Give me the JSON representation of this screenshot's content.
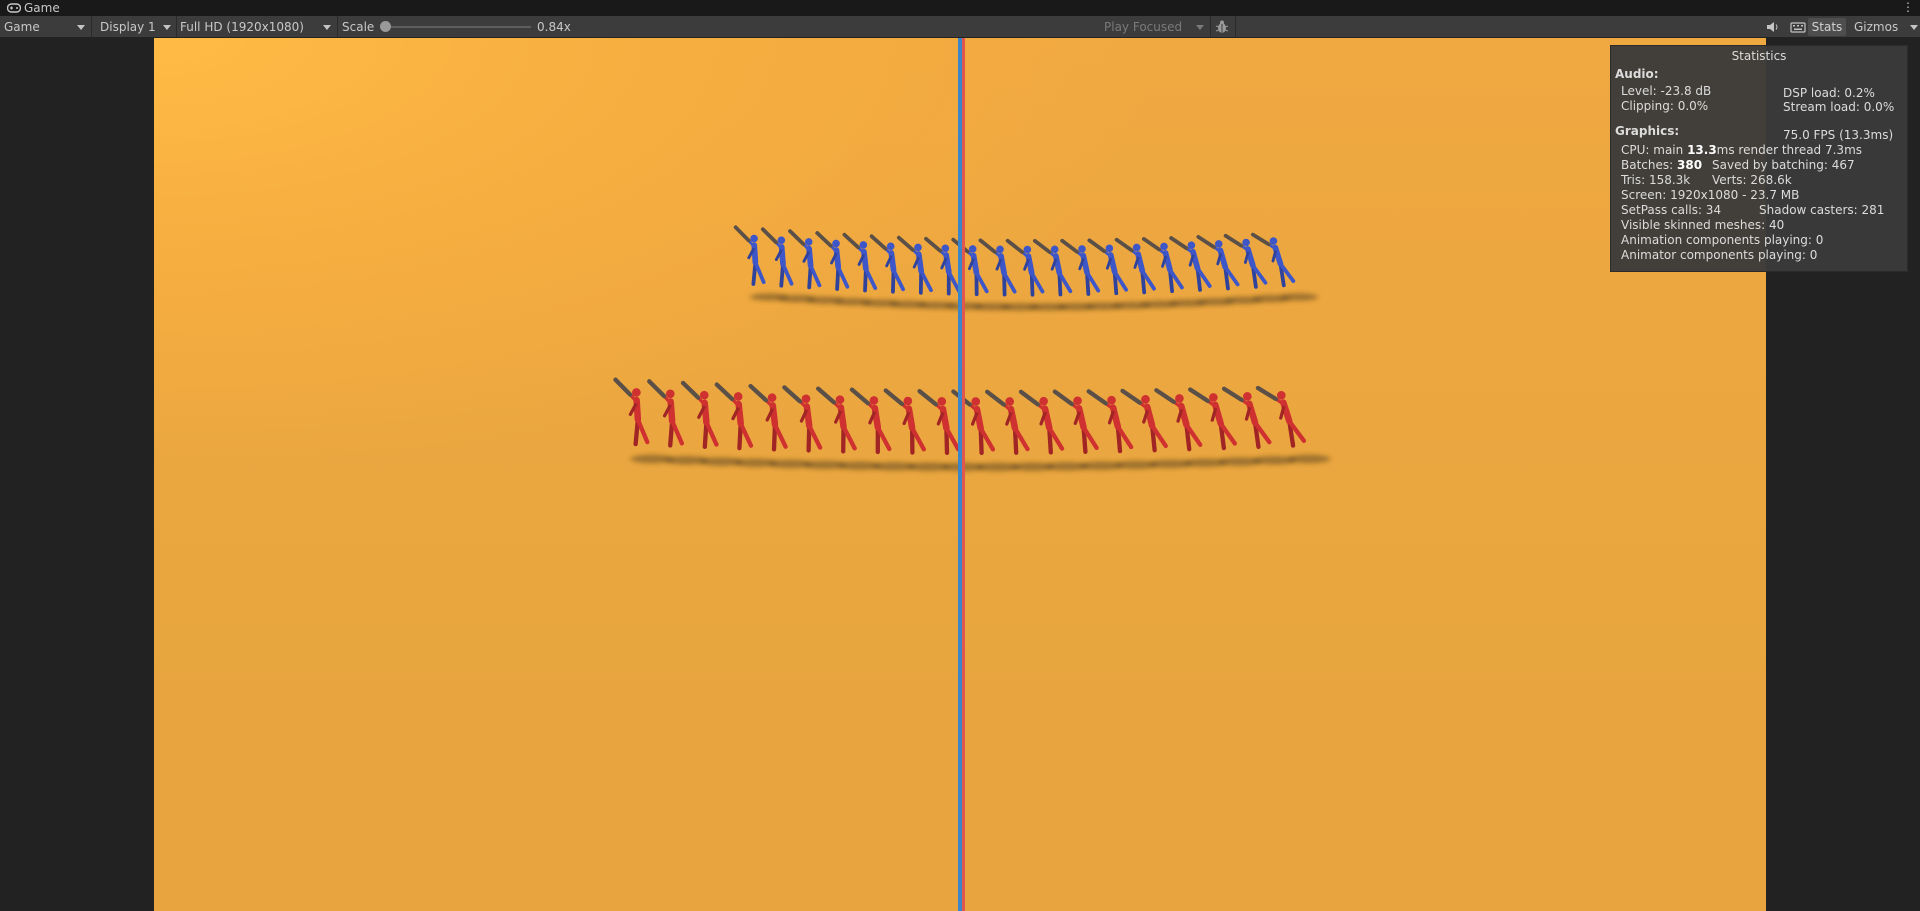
{
  "window": {
    "tab_title": "Game",
    "menu_glyph": "⋮",
    "tab_icon": "gamepad-icon"
  },
  "toolbar": {
    "view_mode": "Game",
    "display": "Display 1",
    "resolution": "Full HD (1920x1080)",
    "scale_label": "Scale",
    "scale_value": "0.84x",
    "scale_fraction": 0.0,
    "play_mode": "Play Focused",
    "stats_label": "Stats",
    "gizmos_label": "Gizmos",
    "icons": [
      "bug-icon",
      "speaker-icon",
      "keyboard-icon"
    ]
  },
  "stats": {
    "title": "Statistics",
    "audio_header": "Audio:",
    "level": "Level: -23.8 dB",
    "clipping": "Clipping: 0.0%",
    "dsp_load": "DSP load: 0.2%",
    "stream_load": "Stream load: 0.0%",
    "graphics_header": "Graphics:",
    "fps": "75.0 FPS (13.3ms)",
    "cpu_prefix": "CPU: main ",
    "cpu_main": "13.3",
    "cpu_suffix": "ms  render thread 7.3ms",
    "batches_prefix": "Batches: ",
    "batches_value": "380",
    "saved_by_batching": "Saved by batching: 467",
    "tris": "Tris: 158.3k",
    "verts": "Verts: 268.6k",
    "screen": "Screen: 1920x1080 - 23.7 MB",
    "setpass": "SetPass calls: 34",
    "shadow_casters": "Shadow casters: 281",
    "skinned_meshes": "Visible skinned meshes: 40",
    "animation_components": "Animation components playing: 0",
    "animator_components": "Animator components playing: 0"
  },
  "scene": {
    "background_color": "#eaa63f",
    "blue_team_color": "#3d56c8",
    "red_team_color": "#cf3030",
    "blue_count": 20,
    "red_count": 20
  }
}
